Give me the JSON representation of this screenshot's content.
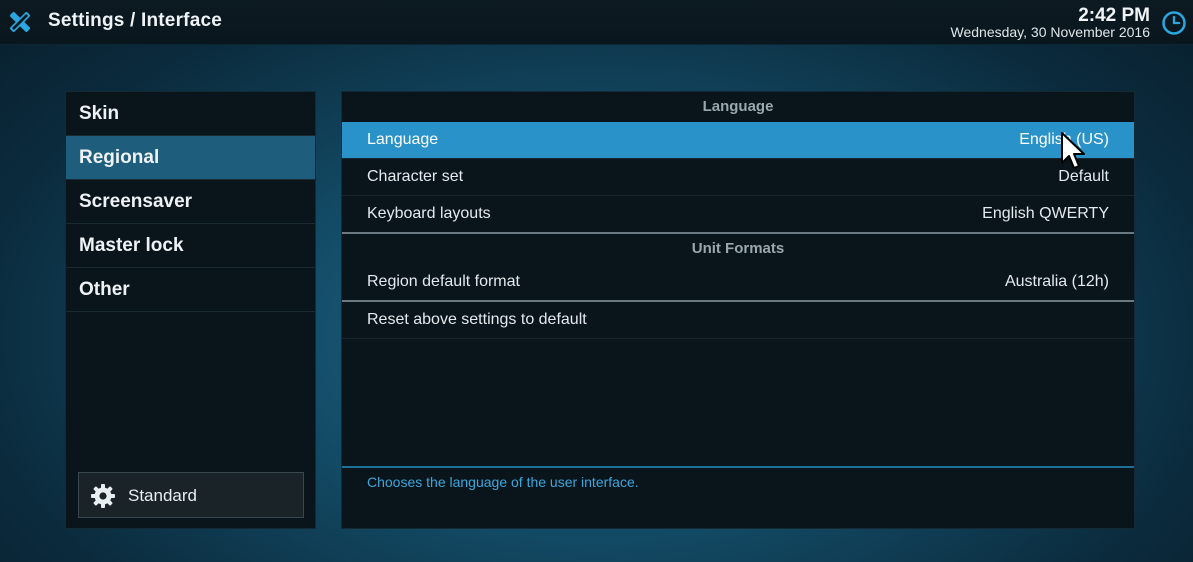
{
  "header": {
    "title": "Settings / Interface",
    "time": "2:42 PM",
    "date": "Wednesday, 30 November 2016"
  },
  "sidebar": {
    "items": [
      {
        "label": "Skin"
      },
      {
        "label": "Regional"
      },
      {
        "label": "Screensaver"
      },
      {
        "label": "Master lock"
      },
      {
        "label": "Other"
      }
    ],
    "active_index": 1,
    "level_button": {
      "label": "Standard",
      "icon": "gear-icon"
    }
  },
  "settings": {
    "groups": [
      {
        "header": "Language",
        "rows": [
          {
            "label": "Language",
            "value": "English (US)"
          },
          {
            "label": "Character set",
            "value": "Default"
          },
          {
            "label": "Keyboard layouts",
            "value": "English QWERTY"
          }
        ]
      },
      {
        "header": "Unit Formats",
        "rows": [
          {
            "label": "Region default format",
            "value": "Australia (12h)"
          }
        ]
      }
    ],
    "action_row": {
      "label": "Reset above settings to default"
    },
    "focused_row": "Language"
  },
  "help": {
    "text": "Chooses the language of the user interface."
  },
  "colors": {
    "accent": "#2992c8",
    "sidebar_active": "#1f5d7d",
    "help_text": "#3aa7dd"
  }
}
